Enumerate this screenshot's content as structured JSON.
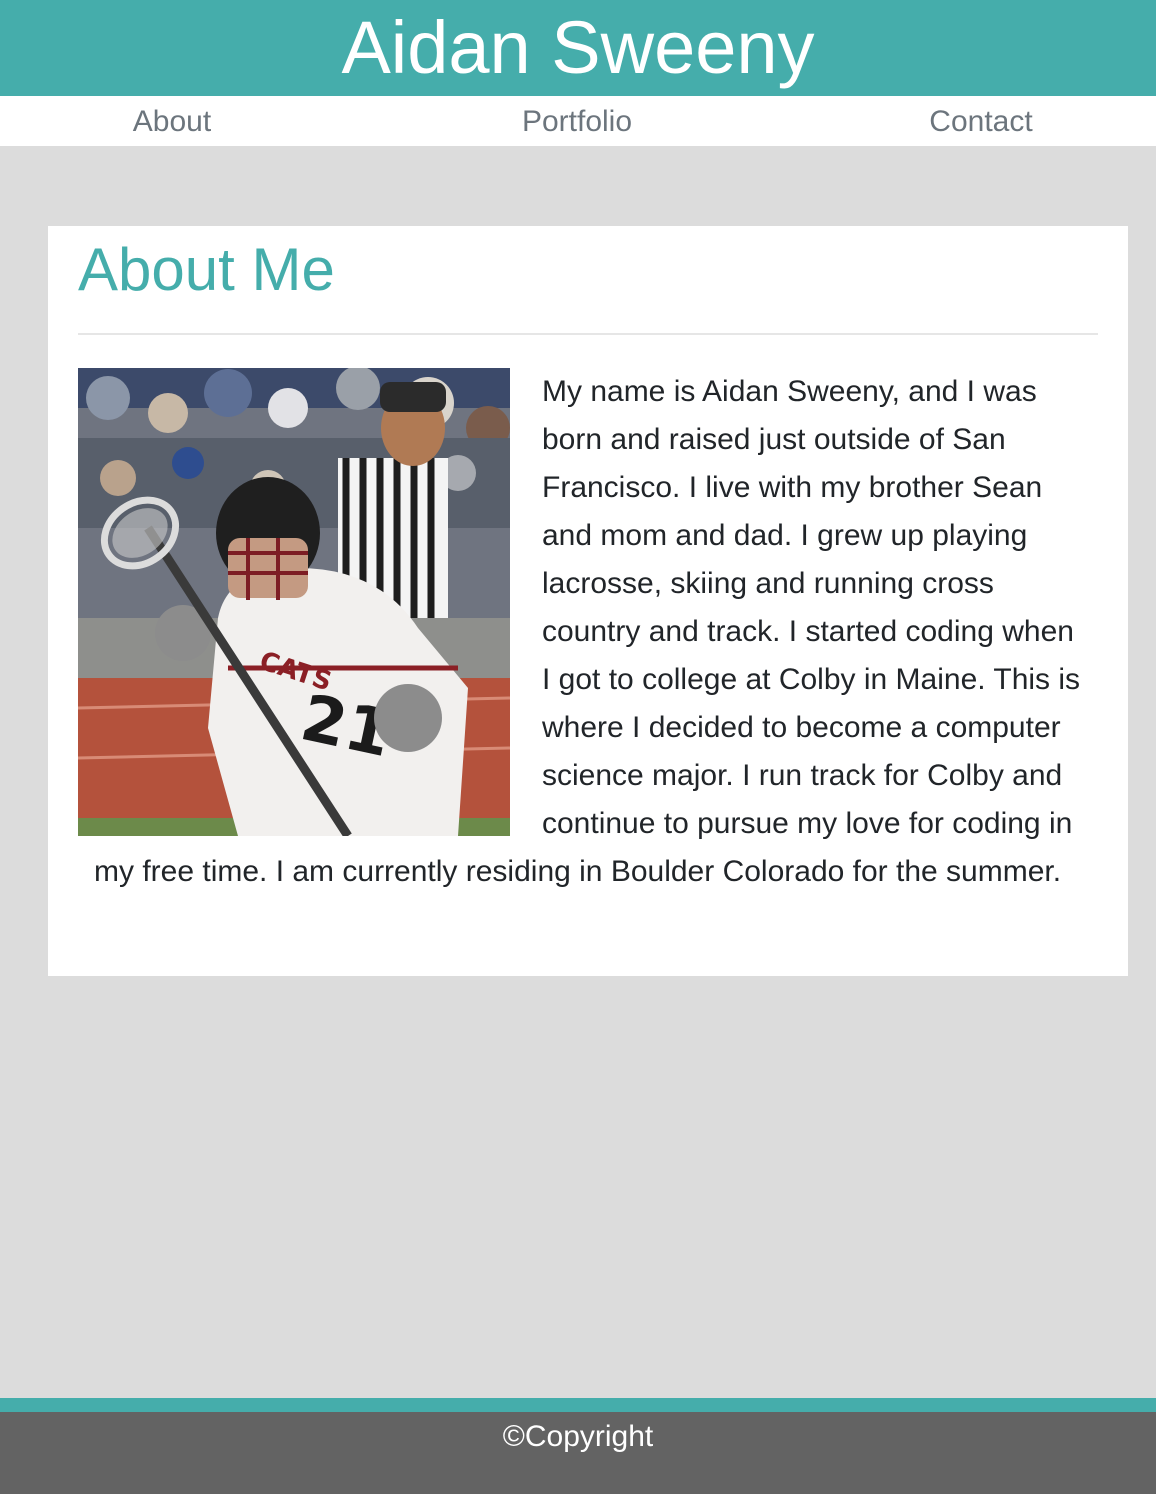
{
  "header": {
    "title": "Aidan Sweeny"
  },
  "nav": {
    "items": [
      {
        "label": "About"
      },
      {
        "label": "Portfolio"
      },
      {
        "label": "Contact"
      }
    ]
  },
  "about": {
    "heading": "About Me",
    "image": {
      "icon": "lacrosse-player-photo"
    },
    "body": "My name is Aidan Sweeny, and I was born and raised just outside of San Francisco. I live with my brother Sean and mom and dad. I grew up playing lacrosse, skiing and running cross country and track. I started coding when I got to college at Colby in Maine. This is where I decided to become a computer science major. I run track for Colby and continue to pursue my love for coding in my free time. I am currently residing in Boulder Colorado for the summer."
  },
  "footer": {
    "copyright": "©Copyright"
  },
  "colors": {
    "accent": "#45adab",
    "page_background": "#dcdcdc",
    "footer_background": "#636363",
    "nav_text": "#6c757d"
  }
}
